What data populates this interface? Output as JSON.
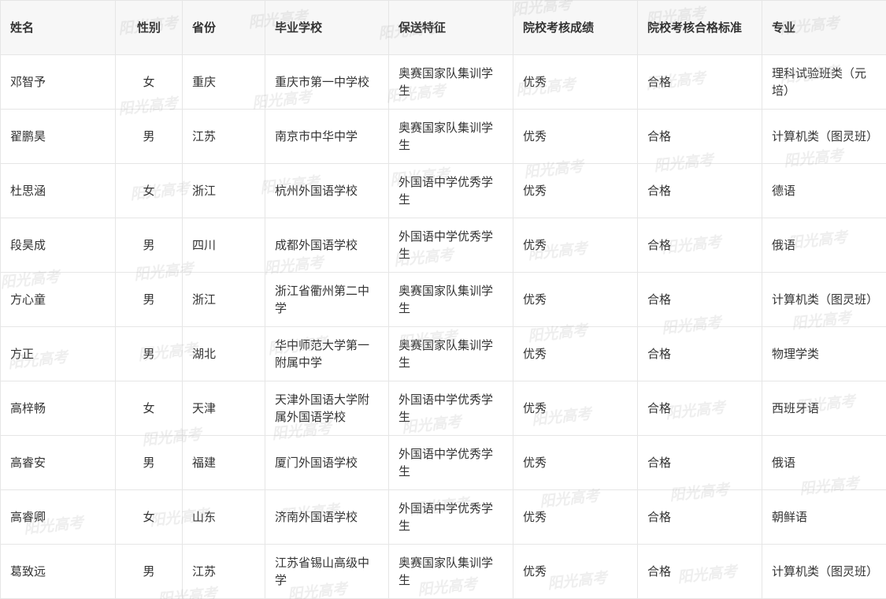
{
  "table": {
    "headers": [
      "姓名",
      "性别",
      "省份",
      "毕业学校",
      "保送特征",
      "院校考核成绩",
      "院校考核合格标准",
      "专业"
    ],
    "rows": [
      [
        "邓智予",
        "女",
        "重庆",
        "重庆市第一中学校",
        "奥赛国家队集训学生",
        "优秀",
        "合格",
        "理科试验班类（元培）"
      ],
      [
        "翟鹏昊",
        "男",
        "江苏",
        "南京市中华中学",
        "奥赛国家队集训学生",
        "优秀",
        "合格",
        "计算机类（图灵班）"
      ],
      [
        "杜思涵",
        "女",
        "浙江",
        "杭州外国语学校",
        "外国语中学优秀学生",
        "优秀",
        "合格",
        "德语"
      ],
      [
        "段昊成",
        "男",
        "四川",
        "成都外国语学校",
        "外国语中学优秀学生",
        "优秀",
        "合格",
        "俄语"
      ],
      [
        "方心童",
        "男",
        "浙江",
        "浙江省衢州第二中学",
        "奥赛国家队集训学生",
        "优秀",
        "合格",
        "计算机类（图灵班）"
      ],
      [
        "方正",
        "男",
        "湖北",
        "华中师范大学第一附属中学",
        "奥赛国家队集训学生",
        "优秀",
        "合格",
        "物理学类"
      ],
      [
        "高梓畅",
        "女",
        "天津",
        "天津外国语大学附属外国语学校",
        "外国语中学优秀学生",
        "优秀",
        "合格",
        "西班牙语"
      ],
      [
        "高睿安",
        "男",
        "福建",
        "厦门外国语学校",
        "外国语中学优秀学生",
        "优秀",
        "合格",
        "俄语"
      ],
      [
        "高睿卿",
        "女",
        "山东",
        "济南外国语学校",
        "外国语中学优秀学生",
        "优秀",
        "合格",
        "朝鲜语"
      ],
      [
        "葛致远",
        "男",
        "江苏",
        "江苏省锡山高级中学",
        "奥赛国家队集训学生",
        "优秀",
        "合格",
        "计算机类（图灵班）"
      ]
    ]
  },
  "watermark": {
    "text": "阳光高考"
  }
}
